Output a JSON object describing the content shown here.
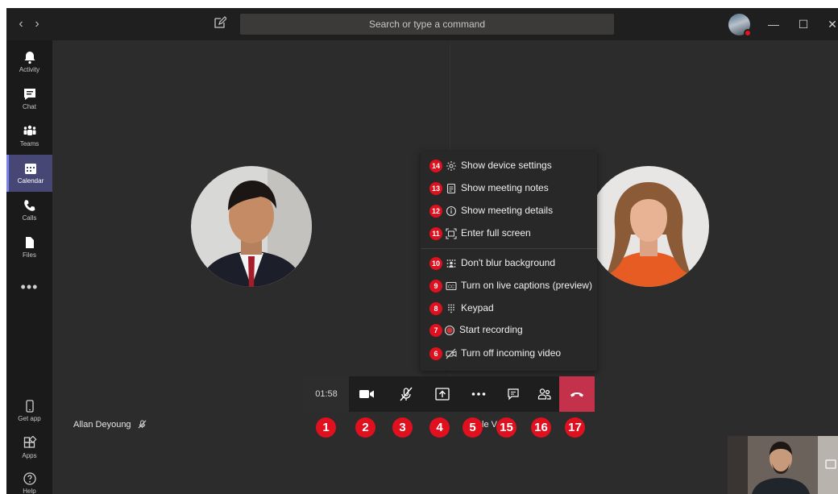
{
  "titlebar": {
    "back_glyph": "‹",
    "forward_glyph": "›",
    "search_placeholder": "Search or type a command",
    "minimize_glyph": "—",
    "maximize_glyph": "☐",
    "close_glyph": "✕"
  },
  "rail": {
    "items": [
      {
        "label": "Activity",
        "icon": "bell-icon"
      },
      {
        "label": "Chat",
        "icon": "chat-icon"
      },
      {
        "label": "Teams",
        "icon": "teams-icon"
      },
      {
        "label": "Calendar",
        "icon": "calendar-icon",
        "active": true
      },
      {
        "label": "Calls",
        "icon": "phone-icon"
      },
      {
        "label": "Files",
        "icon": "file-icon"
      }
    ],
    "more_glyph": "•••",
    "bottom": [
      {
        "label": "Get app",
        "icon": "device-icon"
      },
      {
        "label": "Apps",
        "icon": "apps-icon"
      },
      {
        "label": "Help",
        "icon": "help-icon"
      }
    ]
  },
  "participants": {
    "left_name": "Allan Deyoung",
    "right_name_partial": "le V"
  },
  "more_menu": {
    "items": [
      {
        "badge": "14",
        "label": "Show device settings",
        "icon": "gear-icon"
      },
      {
        "badge": "13",
        "label": "Show meeting notes",
        "icon": "notes-icon"
      },
      {
        "badge": "12",
        "label": "Show meeting details",
        "icon": "info-icon"
      },
      {
        "badge": "11",
        "label": "Enter full screen",
        "icon": "fullscreen-icon"
      },
      {
        "badge": "10",
        "label": "Don't blur background",
        "icon": "blur-icon"
      },
      {
        "badge": "9",
        "label": "Turn on live captions (preview)",
        "icon": "captions-icon"
      },
      {
        "badge": "8",
        "label": "Keypad",
        "icon": "keypad-icon"
      },
      {
        "badge": "7",
        "label": "Start recording",
        "icon": "record-icon"
      },
      {
        "badge": "6",
        "label": "Turn off incoming video",
        "icon": "video-off-icon"
      }
    ]
  },
  "controls": {
    "timer": "01:58"
  },
  "badges": [
    "1",
    "2",
    "3",
    "4",
    "5",
    "15",
    "16",
    "17"
  ],
  "colors": {
    "accent": "#7b83eb",
    "hangup": "#c4314b",
    "badge": "#e0101f",
    "rail_active": "#464775"
  }
}
